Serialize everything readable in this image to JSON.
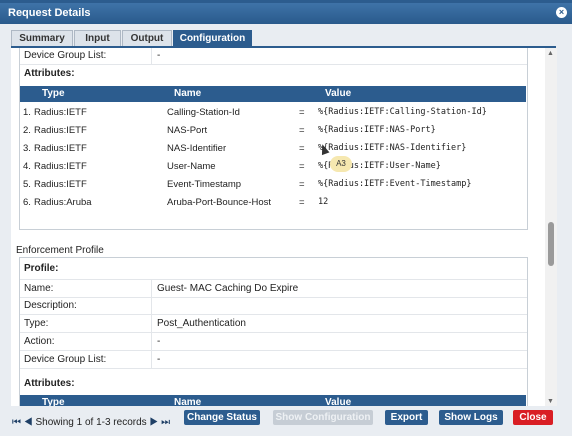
{
  "window": {
    "title": "Request Details"
  },
  "tabs": [
    {
      "label": "Summary"
    },
    {
      "label": "Input"
    },
    {
      "label": "Output"
    },
    {
      "label": "Configuration"
    }
  ],
  "top_panel": {
    "device_group_label": "Device Group List:",
    "device_group_value": "-",
    "attributes_label": "Attributes:",
    "headers": {
      "type": "Type",
      "name": "Name",
      "value": "Value"
    },
    "rows": [
      {
        "num": "1.",
        "type": "Radius:IETF",
        "name": "Calling-Station-Id",
        "eq": "=",
        "value": "%{Radius:IETF:Calling-Station-Id}"
      },
      {
        "num": "2.",
        "type": "Radius:IETF",
        "name": "NAS-Port",
        "eq": "=",
        "value": "%{Radius:IETF:NAS-Port}"
      },
      {
        "num": "3.",
        "type": "Radius:IETF",
        "name": "NAS-Identifier",
        "eq": "=",
        "value": "%{Radius:IETF:NAS-Identifier}"
      },
      {
        "num": "4.",
        "type": "Radius:IETF",
        "name": "User-Name",
        "eq": "=",
        "value": "%{Radius:IETF:User-Name}"
      },
      {
        "num": "5.",
        "type": "Radius:IETF",
        "name": "Event-Timestamp",
        "eq": "=",
        "value": "%{Radius:IETF:Event-Timestamp}"
      },
      {
        "num": "6.",
        "type": "Radius:Aruba",
        "name": "Aruba-Port-Bounce-Host",
        "eq": "=",
        "value": "12"
      }
    ]
  },
  "enforcement": {
    "section_title": "Enforcement Profile",
    "profile_label": "Profile:",
    "fields": [
      {
        "key": "Name:",
        "value": "Guest- MAC Caching Do Expire"
      },
      {
        "key": "Description:",
        "value": ""
      },
      {
        "key": "Type:",
        "value": "Post_Authentication"
      },
      {
        "key": "Action:",
        "value": "-"
      },
      {
        "key": "Device Group List:",
        "value": "-"
      }
    ],
    "attributes_label": "Attributes:",
    "headers": {
      "type": "Type",
      "name": "Name",
      "value": "Value"
    }
  },
  "tooltip": "A3",
  "pager": {
    "first": "⏮",
    "prev": "◀",
    "text": "Showing 1 of 1-3 records",
    "next": "▶",
    "last": "⏭"
  },
  "buttons": {
    "change_status": "Change Status",
    "show_configuration": "Show Configuration",
    "export": "Export",
    "show_logs": "Show Logs",
    "close": "Close"
  },
  "colors": {
    "accent": "#2c5c8e",
    "close": "#d91e24"
  }
}
